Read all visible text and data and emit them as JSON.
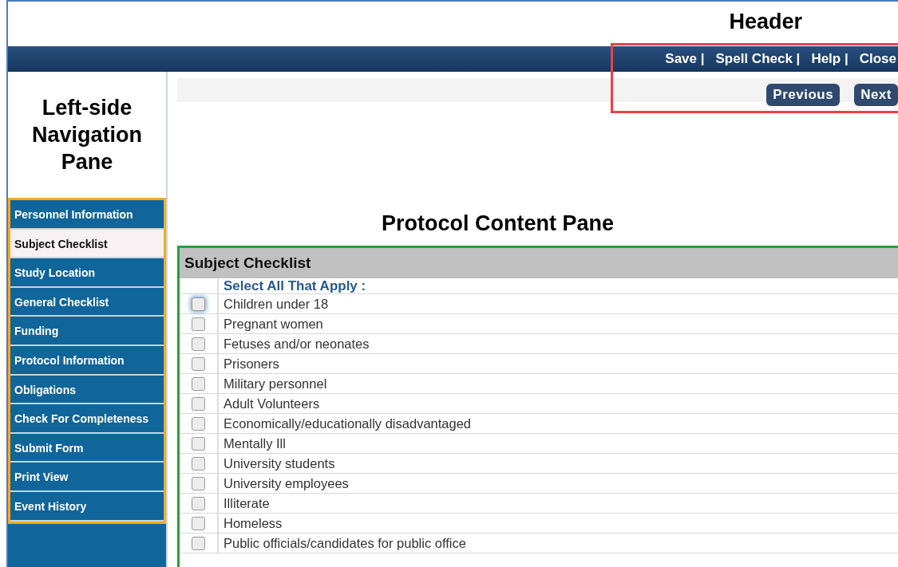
{
  "annotations": [
    {
      "label": "Header",
      "color": "#ec4047"
    },
    {
      "label": "Left-side Navigation Pane",
      "color": "#f5ab1c"
    },
    {
      "label": "Protocol Content Pane",
      "color": "#27a034"
    }
  ],
  "header": {
    "links": [
      "Save |",
      "Spell Check |",
      "Help |",
      "Close"
    ],
    "buttons": [
      "Previous",
      "Next"
    ]
  },
  "nav": {
    "items": [
      {
        "label": "Personnel Information",
        "selected": false
      },
      {
        "label": "Subject Checklist",
        "selected": true
      },
      {
        "label": "Study Location",
        "selected": false
      },
      {
        "label": "General Checklist",
        "selected": false
      },
      {
        "label": "Funding",
        "selected": false
      },
      {
        "label": "Protocol Information",
        "selected": false
      },
      {
        "label": "Obligations",
        "selected": false
      },
      {
        "label": "Check For Completeness",
        "selected": false
      },
      {
        "label": "Submit Form",
        "selected": false
      },
      {
        "label": "Print View",
        "selected": false
      },
      {
        "label": "Event History",
        "selected": false
      }
    ]
  },
  "checklist": {
    "title": "Subject Checklist",
    "instruction": "Select All That Apply :",
    "items": [
      {
        "label": "Children under 18",
        "checked": false,
        "focused": true
      },
      {
        "label": "Pregnant women",
        "checked": false,
        "focused": false
      },
      {
        "label": "Fetuses and/or neonates",
        "checked": false,
        "focused": false
      },
      {
        "label": "Prisoners",
        "checked": false,
        "focused": false
      },
      {
        "label": "Military personnel",
        "checked": false,
        "focused": false
      },
      {
        "label": "Adult Volunteers",
        "checked": false,
        "focused": false
      },
      {
        "label": "Economically/educationally disadvantaged",
        "checked": false,
        "focused": false
      },
      {
        "label": "Mentally Ill",
        "checked": false,
        "focused": false
      },
      {
        "label": "University students",
        "checked": false,
        "focused": false
      },
      {
        "label": "University employees",
        "checked": false,
        "focused": false
      },
      {
        "label": "Illiterate",
        "checked": false,
        "focused": false
      },
      {
        "label": "Homeless",
        "checked": false,
        "focused": false
      },
      {
        "label": "Public officials/candidates for public office",
        "checked": false,
        "focused": false
      }
    ]
  }
}
